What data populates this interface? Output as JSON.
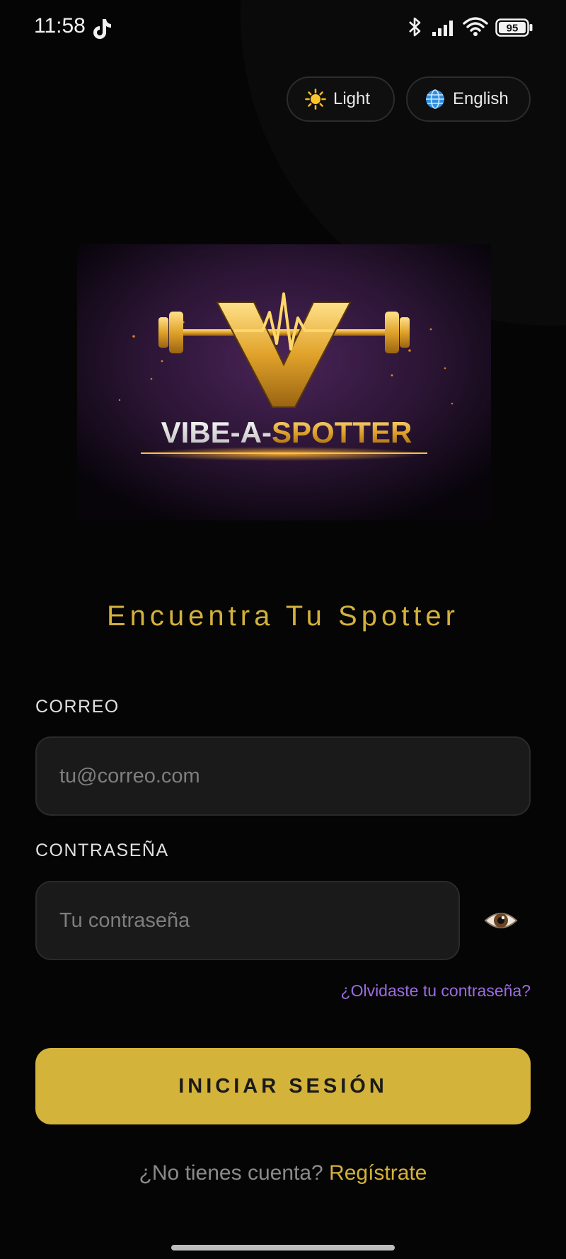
{
  "status_bar": {
    "time": "11:58",
    "battery": "95",
    "icons": [
      "tiktok-icon",
      "bluetooth-icon",
      "signal-icon",
      "wifi-icon",
      "battery-icon"
    ]
  },
  "top_controls": {
    "theme": {
      "icon": "sun-icon",
      "label": "Light"
    },
    "language": {
      "icon": "globe-icon",
      "label": "English"
    }
  },
  "logo": {
    "text_white": "VIBE-A-",
    "text_gold": "SPOTTER"
  },
  "tagline": "Encuentra Tu Spotter",
  "form": {
    "email_label": "CORREO",
    "email_placeholder": "tu@correo.com",
    "email_value": "",
    "password_label": "CONTRASEÑA",
    "password_placeholder": "Tu contraseña",
    "password_value": "",
    "show_password_icon": "eye-icon",
    "forgot_password": "¿Olvidaste tu contraseña?",
    "submit_label": "INICIAR SESIÓN"
  },
  "signup": {
    "prompt": "¿No tienes cuenta?",
    "link": "Regístrate"
  },
  "colors": {
    "background": "#050505",
    "accent_gold": "#d4b33a",
    "link_purple": "#9c6ce0",
    "input_bg": "#1a1a1a"
  }
}
